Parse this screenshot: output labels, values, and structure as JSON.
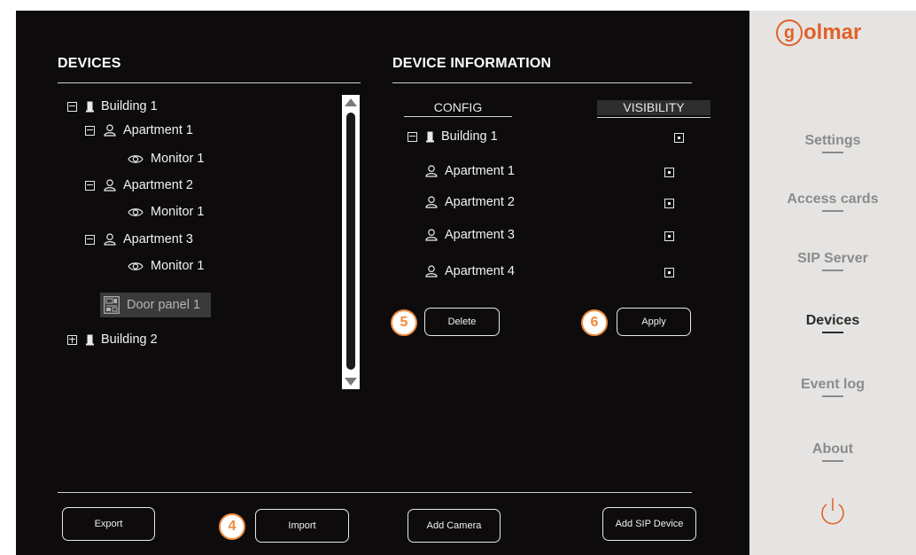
{
  "devices_panel": {
    "title": "DEVICES",
    "tree": {
      "building_1": "Building 1",
      "apartment_1": "Apartment 1",
      "apt1_monitor": "Monitor 1",
      "apartment_2": "Apartment 2",
      "apt2_monitor": "Monitor 1",
      "apartment_3": "Apartment 3",
      "apt3_monitor": "Monitor 1",
      "door_panel": "Door panel 1",
      "building_2": "Building 2"
    }
  },
  "info_panel": {
    "title": "DEVICE INFORMATION",
    "config_header": "CONFIG",
    "visibility_header": "VISIBILITY",
    "rows": [
      "Building 1",
      "Apartment 1",
      "Apartment 2",
      "Apartment 3",
      "Apartment 4"
    ],
    "delete_label": "Delete",
    "apply_label": "Apply"
  },
  "bottom_bar": {
    "export_label": "Export",
    "import_label": "Import",
    "add_camera_label": "Add Camera",
    "add_sip_label": "Add SIP Device"
  },
  "badges": {
    "delete": "5",
    "apply": "6",
    "import": "4"
  },
  "sidebar": {
    "logo_letter": "g",
    "logo_rest": "olmar",
    "items": [
      "Settings",
      "Access cards",
      "SIP Server",
      "Devices",
      "Event log",
      "About"
    ],
    "active": "Devices"
  },
  "colors": {
    "main_bg": "#0d0b0c",
    "sidebar_bg": "#e6e4e2",
    "accent": "#ef8a3c",
    "brand": "#e0622a"
  },
  "icons": {
    "building": "building-icon",
    "apartment": "person-icon",
    "monitor": "eye-icon",
    "door_panel": "door-panel-icon",
    "power": "power-icon"
  }
}
